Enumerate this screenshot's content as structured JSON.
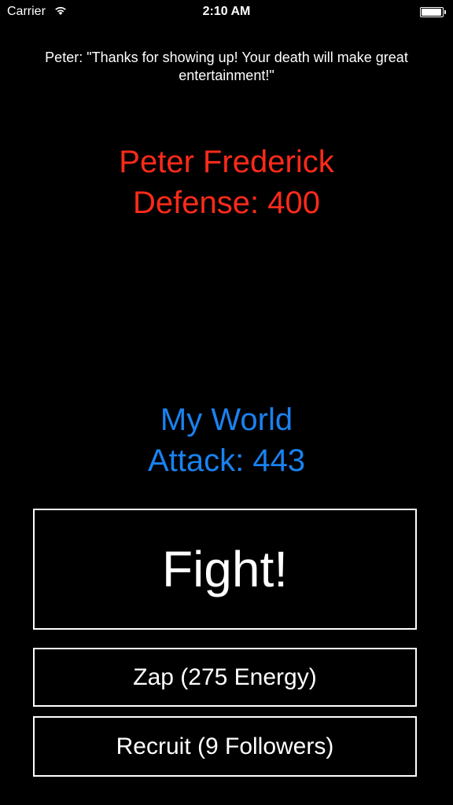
{
  "status_bar": {
    "carrier": "Carrier",
    "time": "2:10 AM",
    "wifi_icon": "wifi-icon",
    "battery_icon": "battery-icon",
    "battery_level": 1.0
  },
  "dialogue": {
    "text": "Peter: \"Thanks for showing up! Your death will make great entertainment!\""
  },
  "enemy": {
    "name": "Peter Frederick",
    "stat": "Defense: 400",
    "color": "#ff2a1a"
  },
  "player": {
    "name": "My World",
    "stat": "Attack: 443",
    "color": "#1a82f0"
  },
  "actions": {
    "fight_label": "Fight!",
    "zap_label": "Zap (275 Energy)",
    "recruit_label": "Recruit (9 Followers)"
  }
}
